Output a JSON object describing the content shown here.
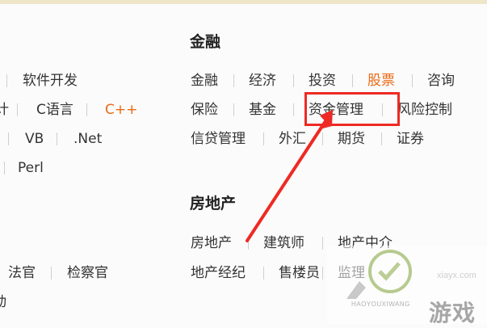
{
  "left_column": {
    "row1": [
      "软件开发"
    ],
    "row2": [
      "计",
      "C语言",
      "C++"
    ],
    "row3": [
      "VB",
      ".Net"
    ],
    "row4": [
      "Perl"
    ],
    "row6": [
      "法官",
      "检察官"
    ],
    "row7": [
      "动"
    ]
  },
  "finance": {
    "heading": "金融",
    "row1": [
      "金融",
      "经济",
      "投资",
      "股票",
      "咨询"
    ],
    "row2": [
      "保险",
      "基金",
      "资金管理",
      "风险控制"
    ],
    "row3": [
      "信贷管理",
      "外汇",
      "期货",
      "证券"
    ]
  },
  "real_estate": {
    "heading": "房地产",
    "row1": [
      "房地产",
      "建筑师",
      "地产中介"
    ],
    "row2": [
      "地产经纪",
      "售楼员",
      "监理"
    ]
  },
  "watermark": {
    "site": "xiayx.com",
    "name": "游戏",
    "sub": "HAOYOUXIWANG"
  },
  "colors": {
    "highlight_text": "#ea6a14",
    "annotation": "#ee2a24"
  },
  "icons": {
    "annotation_arrow": "red-arrow-icon",
    "watermark_logo": "site-logo-icon"
  }
}
